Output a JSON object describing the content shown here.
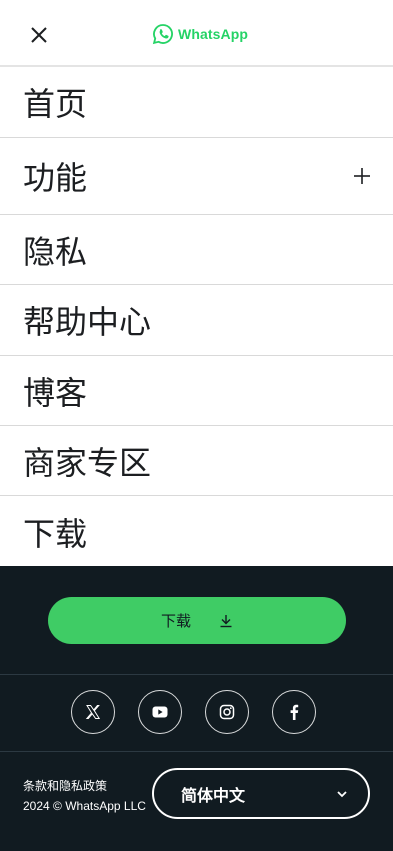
{
  "header": {
    "brand": "WhatsApp",
    "brand_color": "#25d366",
    "close_icon": "close-icon"
  },
  "nav": {
    "items": [
      {
        "label": "首页"
      },
      {
        "label": "功能",
        "expandable": true
      },
      {
        "label": "隐私"
      },
      {
        "label": "帮助中心"
      },
      {
        "label": "博客"
      },
      {
        "label": "商家专区"
      },
      {
        "label": "下载"
      }
    ]
  },
  "footer": {
    "download_label": "下载",
    "download_color": "#3fcc65",
    "background": "#111b21",
    "social": [
      "x-icon",
      "youtube-icon",
      "instagram-icon",
      "facebook-icon"
    ],
    "legal_link": "条款和隐私政策",
    "copyright": "2024 © WhatsApp LLC",
    "language": "简体中文"
  }
}
